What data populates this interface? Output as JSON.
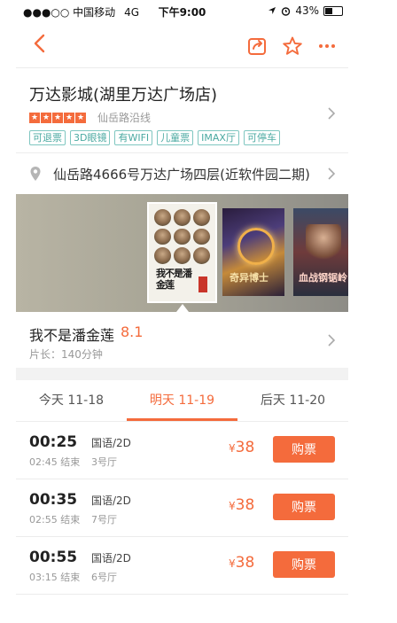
{
  "status_bar": {
    "carrier": "●●●○○ 中国移动",
    "network": "4G",
    "time": "下午9:00",
    "battery": "43%",
    "battery_level": 0.43
  },
  "nav": {
    "icons": [
      "back-arrow-icon",
      "share-icon",
      "star-icon",
      "more-icon"
    ]
  },
  "cinema": {
    "name": "万达影城(湖里万达广场店)",
    "stars": 5,
    "area": "仙岳路沿线",
    "tags": [
      "可退票",
      "3D眼镜",
      "有WIFI",
      "儿童票",
      "IMAX厅",
      "可停车"
    ],
    "address": "仙岳路4666号万达广场四层(近软件园二期)"
  },
  "posters": {
    "main_title": "我不是潘金莲",
    "second_title": "奇异博士",
    "third_title": "血战钢锯岭"
  },
  "movie": {
    "title": "我不是潘金莲",
    "score": "8.1",
    "length": "片长：140分钟"
  },
  "date_tabs": [
    {
      "label": "今天 11-18",
      "active": false
    },
    {
      "label": "明天 11-19",
      "active": true
    },
    {
      "label": "后天 11-20",
      "active": false
    }
  ],
  "showtimes": [
    {
      "start": "00:25",
      "end": "02:45 结束",
      "lang": "国语/2D",
      "hall": "3号厅",
      "currency": "¥",
      "price": "38",
      "buy": "购票"
    },
    {
      "start": "00:35",
      "end": "02:55 结束",
      "lang": "国语/2D",
      "hall": "7号厅",
      "currency": "¥",
      "price": "38",
      "buy": "购票"
    },
    {
      "start": "00:55",
      "end": "03:15 结束",
      "lang": "国语/2D",
      "hall": "6号厅",
      "currency": "¥",
      "price": "38",
      "buy": "购票"
    }
  ],
  "colors": {
    "accent": "#f46b3c",
    "tag": "#4aa9a1"
  }
}
